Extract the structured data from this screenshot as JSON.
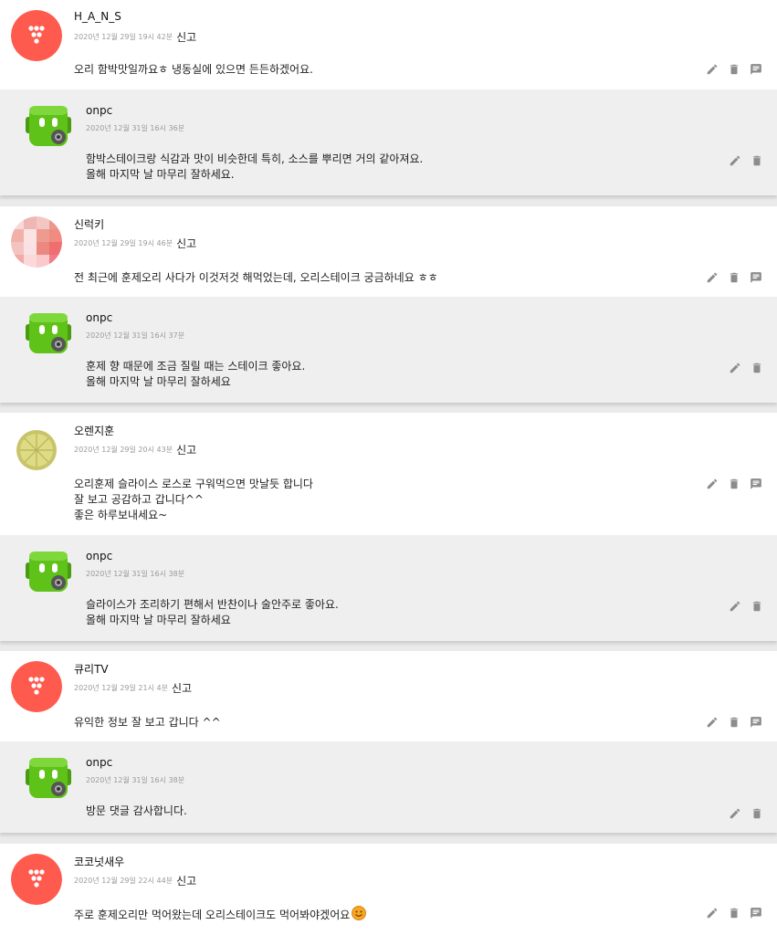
{
  "comments": [
    {
      "author": "H_A_N_S",
      "date": "2020년 12월 29일 19시 42분",
      "report_label": "신고",
      "avatar_icon": "red-dots-avatar",
      "body": "오리 함박맛일까요ㅎ 냉동실에 있으면 든든하겠어요.",
      "reply": {
        "author": "onpc",
        "date": "2020년 12월 31일 16시 36분",
        "avatar_icon": "green-robot-avatar",
        "body": "함박스테이크랑 식감과 맛이 비슷한데 특히, 소스를 뿌리면 거의 같아져요.\n올해 마지막 날 마무리 잘하세요."
      }
    },
    {
      "author": "신럭키",
      "date": "2020년 12월 29일 19시 46분",
      "report_label": "신고",
      "avatar_icon": "pink-pixel-avatar",
      "body": "전 최근에 훈제오리 사다가 이것저것 해먹었는데, 오리스테이크 궁금하네요 ㅎㅎ",
      "reply": {
        "author": "onpc",
        "date": "2020년 12월 31일 16시 37분",
        "avatar_icon": "green-robot-avatar",
        "body": "훈제 향 때문에 조금 질릴 때는 스테이크 좋아요.\n올해 마지막 날 마무리 잘하세요"
      }
    },
    {
      "author": "오렌지훈",
      "date": "2020년 12월 29일 20시 43분",
      "report_label": "신고",
      "avatar_icon": "lemon-slice-avatar",
      "body": "오리훈제 슬라이스 로스로 구워먹으면 맛날듯 합니다\n잘 보고 공감하고 갑니다^^\n좋은 하루보내세요~",
      "reply": {
        "author": "onpc",
        "date": "2020년 12월 31일 16시 38분",
        "avatar_icon": "green-robot-avatar",
        "body": "슬라이스가 조리하기 편해서 반찬이나 술안주로 좋아요.\n올해 마지막 날 마무리 잘하세요"
      }
    },
    {
      "author": "큐리TV",
      "date": "2020년 12월 29일 21시 4분",
      "report_label": "신고",
      "avatar_icon": "red-dots-avatar",
      "body": "유익한 정보 잘 보고 갑니다 ^^",
      "reply": {
        "author": "onpc",
        "date": "2020년 12월 31일 16시 38분",
        "avatar_icon": "green-robot-avatar",
        "body": "방문 댓글 감사합니다."
      }
    },
    {
      "author": "코코넛새우",
      "date": "2020년 12월 29일 22시 44분",
      "report_label": "신고",
      "avatar_icon": "red-dots-avatar",
      "body": "주로 훈제오리만 먹어왔는데 오리스테이크도 먹어봐야겠어요",
      "has_emoji": true,
      "emoji_icon": "smile-emoji-icon",
      "reply": null
    }
  ],
  "action_icons": {
    "edit": "pencil-icon",
    "delete": "trash-icon",
    "reply": "comment-icon"
  },
  "colors": {
    "page_bg": "#eaeaea",
    "comment_bg": "#ffffff",
    "reply_bg": "#efefef",
    "avatar_red": "#ff5a4e",
    "robot_green": "#5ec218",
    "icon_gray": "#8c8c8c"
  }
}
